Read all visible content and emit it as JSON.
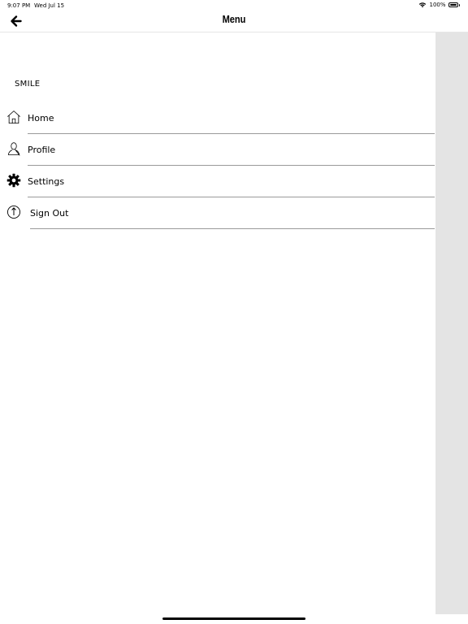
{
  "status_bar": {
    "time": "9:07 PM",
    "date": "Wed Jul 15",
    "battery_text": "100%",
    "battery_level": 1.0,
    "wifi_icon": "wifi-icon",
    "battery_icon": "battery-icon"
  },
  "nav": {
    "title": "Menu",
    "back_icon": "back-arrow-icon"
  },
  "menu": {
    "brand": "SMILE",
    "items": [
      {
        "label": "Home",
        "icon": "home-icon"
      },
      {
        "label": "Profile",
        "icon": "person-icon"
      },
      {
        "label": "Settings",
        "icon": "gear-icon"
      },
      {
        "label": "Sign Out",
        "icon": "power-icon"
      }
    ]
  },
  "colors": {
    "background": "#ffffff",
    "overlay": "#e4e4e4",
    "divider": "#9a9a9a",
    "text": "#000000"
  }
}
